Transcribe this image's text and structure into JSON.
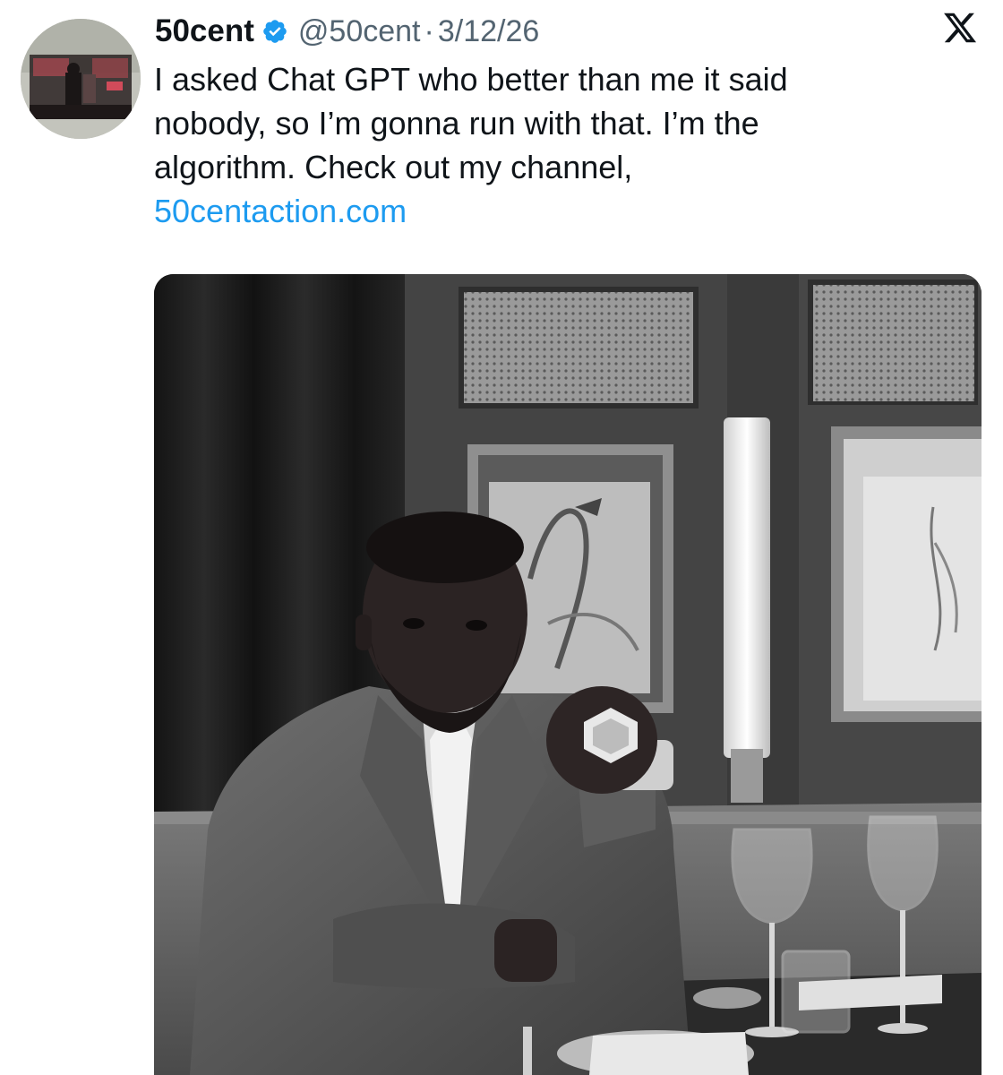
{
  "tweet": {
    "display_name": "50cent",
    "handle": "@50cent",
    "separator": "·",
    "date": "3/12/26",
    "text_lines": [
      "I asked Chat GPT who better than me it said",
      "nobody, so I’m gonna run with that. I’m the",
      "algorithm. Check out my channel,"
    ],
    "link_text": "50centaction.com",
    "icons": {
      "verified": "verified-badge-icon",
      "platform": "x-logo-icon"
    },
    "colors": {
      "name": "#0f1419",
      "secondary": "#536471",
      "link": "#1d9bf0",
      "verified": "#1d9bf0"
    }
  }
}
